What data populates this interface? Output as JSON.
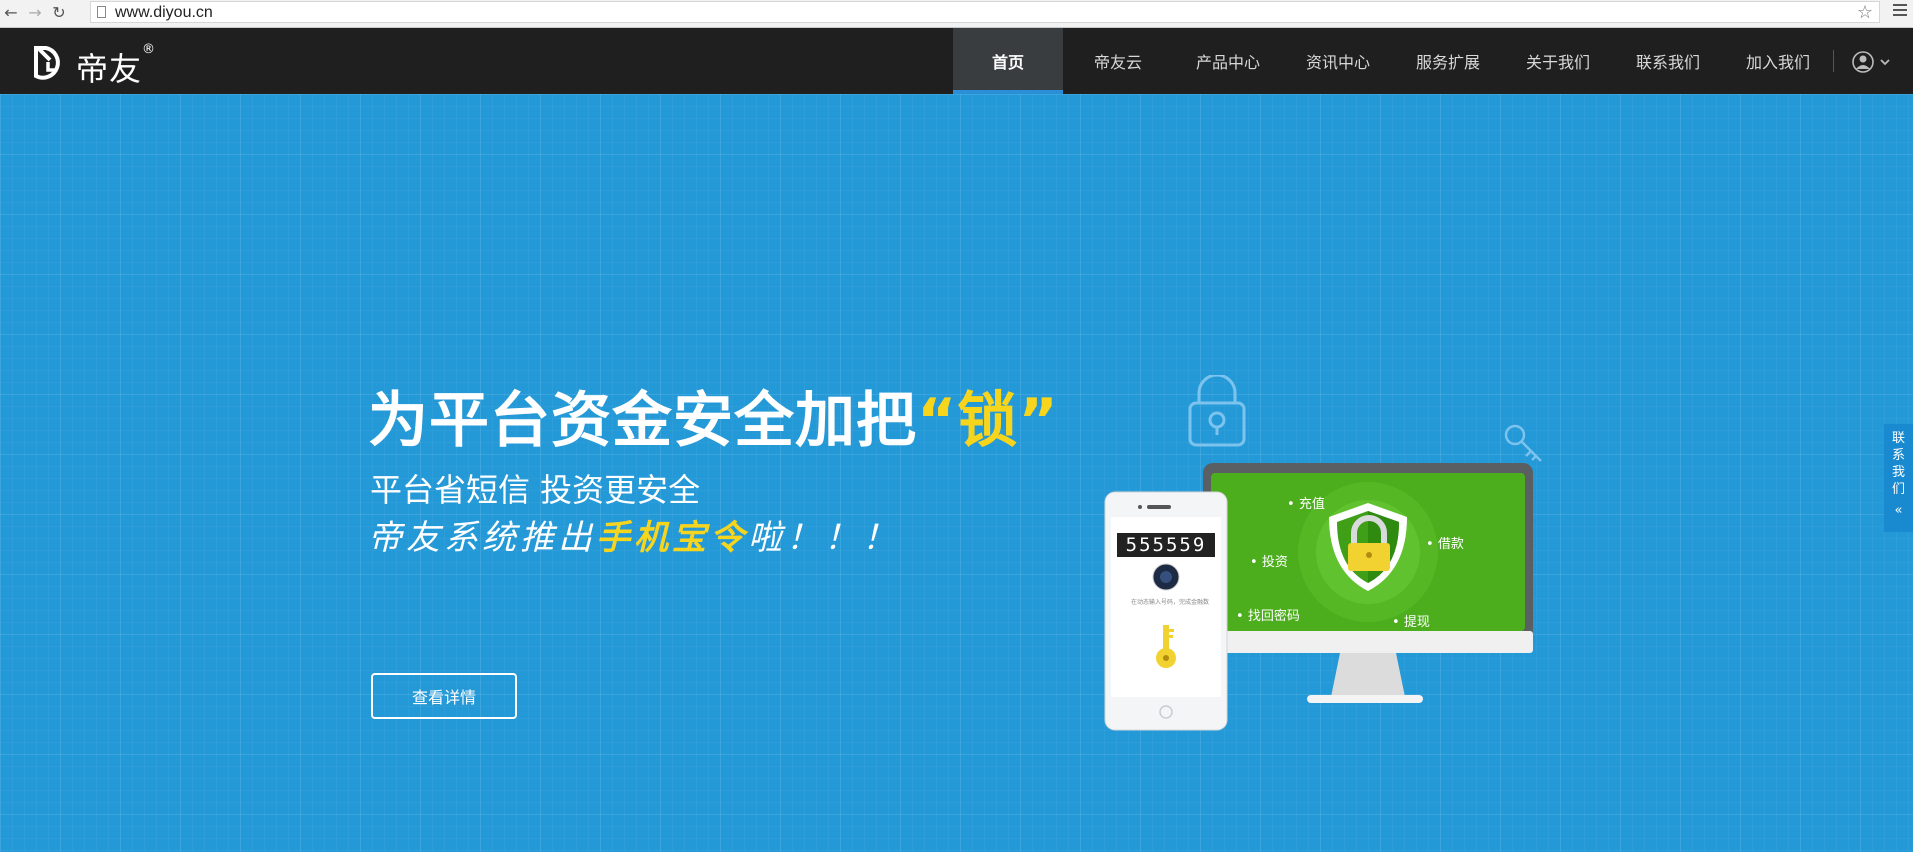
{
  "browser": {
    "url": "www.diyou.cn"
  },
  "header": {
    "logo_text": "帝友",
    "logo_reg": "®",
    "nav": [
      {
        "label": "首页",
        "active": true
      },
      {
        "label": "帝友云"
      },
      {
        "label": "产品中心"
      },
      {
        "label": "资讯中心"
      },
      {
        "label": "服务扩展"
      },
      {
        "label": "关于我们"
      },
      {
        "label": "联系我们"
      },
      {
        "label": "加入我们"
      }
    ]
  },
  "hero": {
    "headline_prefix": "为平台资金安全加把",
    "headline_accent": "“锁”",
    "subline": "平台省短信 投资更安全",
    "tagline_prefix": "帝友系统推出",
    "tagline_accent": "手机宝令",
    "tagline_suffix": "啦！！！",
    "cta_label": "查看详情"
  },
  "illustration": {
    "phone_code": "555559",
    "phone_caption": "在动态输入号码，完成金融数",
    "monitor_labels": {
      "recharge": "充值",
      "loan": "借款",
      "invest": "投资",
      "recover_password": "找回密码",
      "withdraw": "提现"
    }
  },
  "contact_tab": {
    "label_chars": [
      "联",
      "系",
      "我",
      "们"
    ],
    "chevron": "«"
  },
  "colors": {
    "hero_bg": "#2499d8",
    "header_bg": "#1f1f1f",
    "accent_yellow": "#f8d51d",
    "screen_green": "#4cae1d"
  }
}
